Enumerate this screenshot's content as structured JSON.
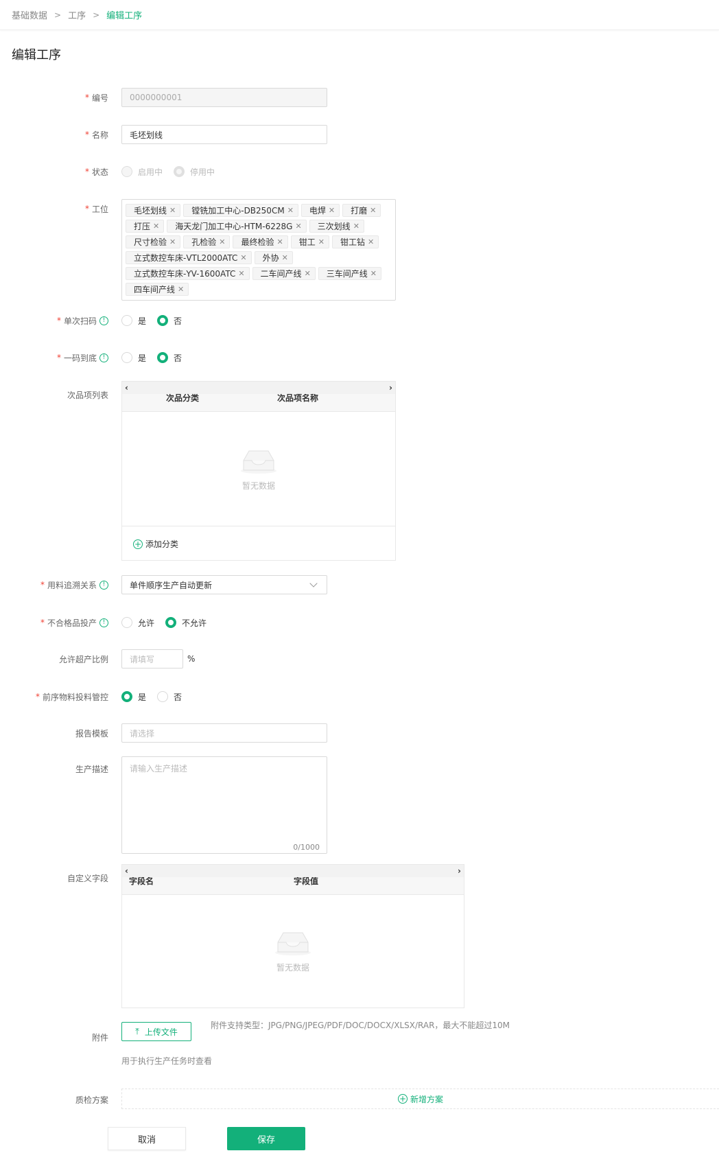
{
  "breadcrumb": {
    "items": [
      "基础数据",
      "工序",
      "编辑工序"
    ],
    "separator": ">"
  },
  "page_title": "编辑工序",
  "fields": {
    "code": {
      "label": "编号",
      "value": "0000000001"
    },
    "name": {
      "label": "名称",
      "value": "毛坯划线"
    },
    "status": {
      "label": "状态",
      "options": [
        "启用中",
        "停用中"
      ],
      "selected": "停用中"
    },
    "stations": {
      "label": "工位",
      "tags": [
        "毛坯划线",
        "镗铣加工中心-DB250CM",
        "电焊",
        "打磨",
        "打压",
        "海天龙门加工中心-HTM-6228G",
        "三次划线",
        "尺寸检验",
        "孔检验",
        "最终检验",
        "钳工",
        "钳工钻",
        "立式数控车床-VTL2000ATC",
        "外协",
        "立式数控车床-YV-1600ATC",
        "二车间产线",
        "三车间产线",
        "四车间产线"
      ]
    },
    "single_scan": {
      "label": "单次扫码",
      "options": [
        "是",
        "否"
      ],
      "selected": "否"
    },
    "one_code": {
      "label": "一码到底",
      "options": [
        "是",
        "否"
      ],
      "selected": "否"
    },
    "defect_list": {
      "label": "次品项列表",
      "columns": [
        "次品分类",
        "次品项名称"
      ],
      "empty_text": "暂无数据",
      "add_label": "添加分类"
    },
    "trace": {
      "label": "用料追溯关系",
      "value": "单件顺序生产自动更新"
    },
    "unqualified": {
      "label": "不合格品投产",
      "options": [
        "允许",
        "不允许"
      ],
      "selected": "不允许"
    },
    "overproduce": {
      "label": "允许超产比例",
      "placeholder": "请填写",
      "unit": "%"
    },
    "material_control": {
      "label": "前序物料投料管控",
      "options": [
        "是",
        "否"
      ],
      "selected": "是"
    },
    "report_template": {
      "label": "报告模板",
      "placeholder": "请选择"
    },
    "description": {
      "label": "生产描述",
      "placeholder": "请输入生产描述",
      "counter": "0/1000"
    },
    "custom_fields": {
      "label": "自定义字段",
      "columns": [
        "字段名",
        "字段值"
      ],
      "empty_text": "暂无数据"
    },
    "attachment": {
      "label": "附件",
      "button": "上传文件",
      "hint": "附件支持类型：JPG/PNG/JPEG/PDF/DOC/DOCX/XLSX/RAR，最大不能超过10M",
      "note": "用于执行生产任务时查看"
    },
    "qc_plan": {
      "label": "质检方案",
      "add_label": "新增方案"
    }
  },
  "actions": {
    "cancel": "取消",
    "save": "保存"
  },
  "colors": {
    "accent": "#13b07a",
    "required": "#f04134"
  }
}
